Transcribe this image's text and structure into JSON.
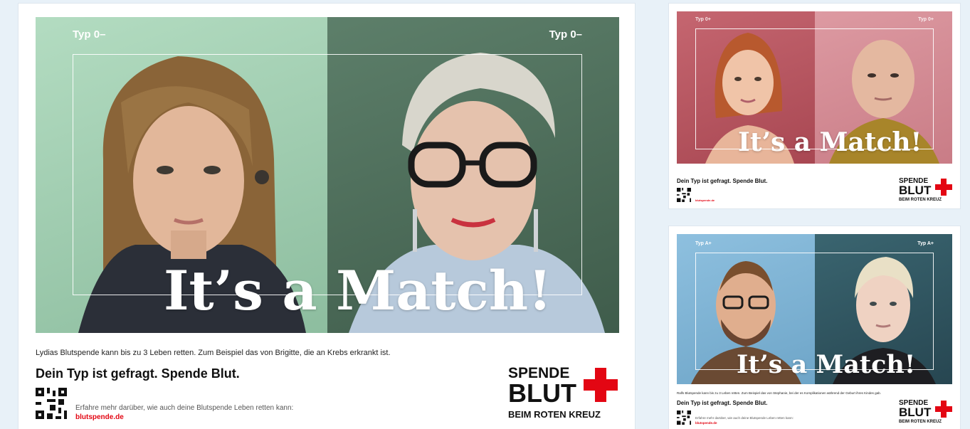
{
  "posters": [
    {
      "type_left": "Typ 0–",
      "type_right": "Typ 0–",
      "headline": "It’s a Match!",
      "caption": "Lydias Blutspende kann bis zu 3 Leben retten. Zum Beispiel das von Brigitte, die an Krebs erkrankt ist.",
      "tagline": "Dein Typ ist gefragt. Spende Blut.",
      "info_text": "Erfahre mehr darüber, wie auch deine Blutspende Leben retten kann:",
      "link": "blutspende.de",
      "logo": {
        "line1": "SPENDE",
        "line2": "BLUT",
        "line3": "BEIM ROTEN KREUZ"
      },
      "colors": {
        "left_bg": "#9cc9ad",
        "right_bg": "#4f6f5c"
      }
    },
    {
      "type_left": "Typ 0+",
      "type_right": "Typ 0+",
      "headline": "It’s a Match!",
      "caption": "",
      "tagline": "Dein Typ ist gefragt. Spende Blut.",
      "info_text": "",
      "link": "blutspende.de",
      "logo": {
        "line1": "SPENDE",
        "line2": "BLUT",
        "line3": "BEIM ROTEN KREUZ"
      },
      "colors": {
        "left_bg": "#b9545e",
        "right_bg": "#d98d95"
      }
    },
    {
      "type_left": "Typ A+",
      "type_right": "Typ A+",
      "headline": "It’s a Match!",
      "caption": "Ralfs Blutspende kann bis zu 3 Leben retten. Zum Beispiel das von Stephanie, bei der es Komplikationen während der Geburt ihres Kindes gab.",
      "tagline": "Dein Typ ist gefragt. Spende Blut.",
      "info_text": "Erfahre mehr darüber, wie auch deine Blutspende Leben retten kann:",
      "link": "blutspende.de",
      "logo": {
        "line1": "SPENDE",
        "line2": "BLUT",
        "line3": "BEIM ROTEN KREUZ"
      },
      "colors": {
        "left_bg": "#7fb3d3",
        "right_bg": "#2f5560"
      }
    }
  ]
}
